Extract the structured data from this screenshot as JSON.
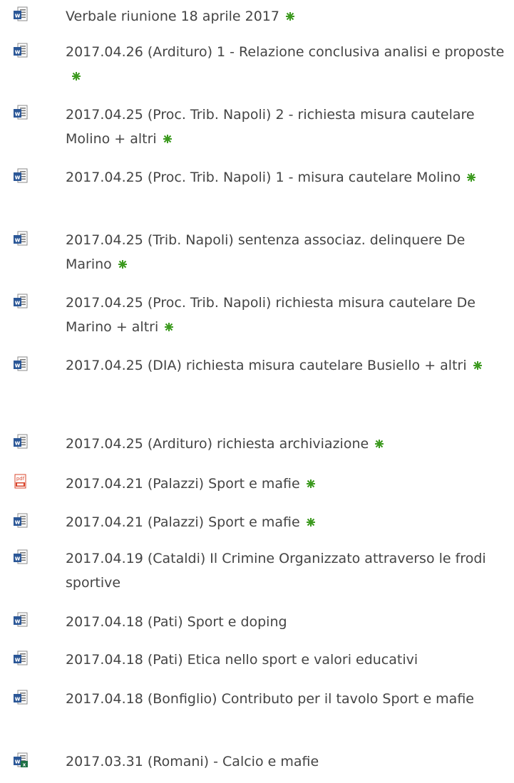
{
  "documents": [
    {
      "title": "Verbale riunione 18 aprile 2017",
      "icon": "word-doc-icon",
      "is_new": true
    },
    {
      "title": "2017.04.26 (Ardituro) 1 - Relazione conclusiva analisi e proposte",
      "icon": "word-doc-icon",
      "is_new": true
    },
    {
      "title": "2017.04.25 (Proc. Trib. Napoli) 2 - richiesta misura cautelare Molino + altri",
      "icon": "word-doc-icon",
      "is_new": true
    },
    {
      "title": "2017.04.25 (Proc. Trib. Napoli) 1 - misura cautelare Molino",
      "icon": "word-doc-icon",
      "is_new": true
    },
    {
      "title": "2017.04.25 (Trib. Napoli) sentenza associaz. delinquere De Marino",
      "icon": "word-doc-icon",
      "is_new": true
    },
    {
      "title": "2017.04.25 (Proc. Trib. Napoli) richiesta misura cautelare De Marino + altri",
      "icon": "word-doc-icon",
      "is_new": true
    },
    {
      "title": "2017.04.25 (DIA) richiesta misura cautelare Busiello + altri",
      "icon": "word-doc-icon",
      "is_new": true
    },
    {
      "title": "2017.04.25 (Ardituro) richiesta archiviazione",
      "icon": "word-doc-icon",
      "is_new": true
    },
    {
      "title": "2017.04.21 (Palazzi) Sport e mafie",
      "icon": "pdf-icon",
      "is_new": true
    },
    {
      "title": "2017.04.21 (Palazzi) Sport e mafie",
      "icon": "word-doc-icon",
      "is_new": true
    },
    {
      "title": "2017.04.19 (Cataldi) Il Crimine Organizzato attraverso le frodi sportive",
      "icon": "word-doc-icon",
      "is_new": false
    },
    {
      "title": "2017.04.18 (Pati) Sport e doping",
      "icon": "word-doc-icon",
      "is_new": false
    },
    {
      "title": "2017.04.18 (Pati) Etica nello sport e valori educativi",
      "icon": "word-doc-icon",
      "is_new": false
    },
    {
      "title": "2017.04.18 (Bonfiglio) Contributo per il tavolo Sport e mafie",
      "icon": "word-doc-icon",
      "is_new": false
    },
    {
      "title": "2017.03.31 (Romani) - Calcio e mafie",
      "icon": "word-excel-doc-icon",
      "is_new": false
    }
  ],
  "colors": {
    "text": "#444444",
    "new_marker": "#3c9a1f",
    "word_blue": "#2b5797",
    "pdf_red": "#d9442b",
    "excel_green": "#1e7145"
  }
}
